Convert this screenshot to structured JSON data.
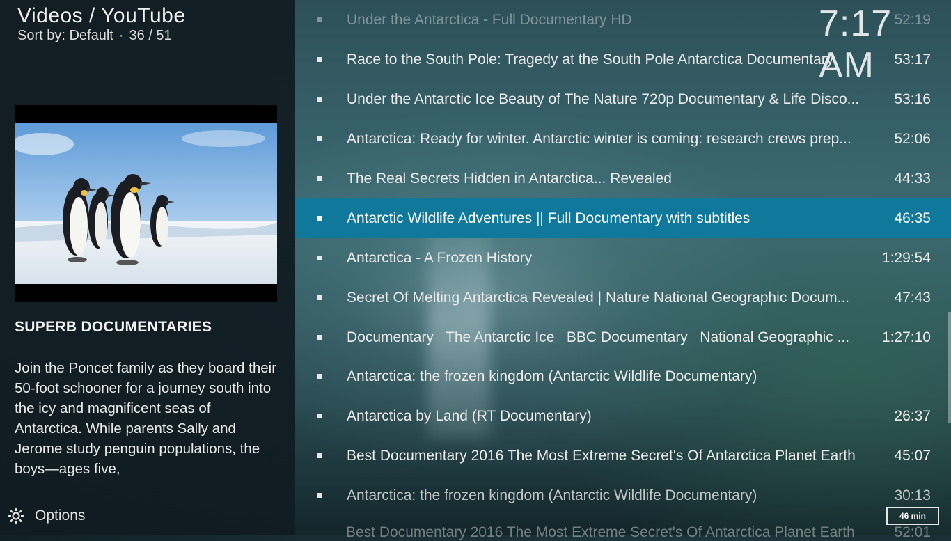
{
  "header": {
    "title": "Videos / YouTube",
    "sort_label": "Sort by: Default",
    "separator": "·",
    "position": "36 / 51"
  },
  "clock": "7:17 AM",
  "info": {
    "plot_title": "SUPERB DOCUMENTARIES",
    "plot": "Join the Poncet family as they board their 50-foot schooner for a journey south into the icy and magnificent seas of Antarctica. While parents Sally and Jerome study penguin populations, the boys—ages five,"
  },
  "options_label": "Options",
  "badge": "46 min",
  "items": [
    {
      "label": "Under the Antarctica - Full Documentary HD",
      "duration": "52:19"
    },
    {
      "label": "Race to the South Pole: Tragedy at the South Pole Antarctica Documentary",
      "duration": "53:17"
    },
    {
      "label": "Under the Antarctic Ice Beauty of The Nature 720p Documentary & Life Disco...",
      "duration": "53:16"
    },
    {
      "label": "Antarctica: Ready for winter. Antarctic winter is coming: research crews prep...",
      "duration": "52:06"
    },
    {
      "label": "The Real Secrets Hidden in Antarctica... Revealed",
      "duration": "44:33"
    },
    {
      "label": "Antarctic Wildlife Adventures || Full Documentary with subtitles",
      "duration": "46:35"
    },
    {
      "label": "Antarctica - A Frozen History",
      "duration": "1:29:54"
    },
    {
      "label": "Secret Of Melting Antarctica Revealed | Nature National Geographic Docum...",
      "duration": "47:43"
    },
    {
      "label": "Documentary   The Antarctic Ice   BBC Documentary   National Geographic ...",
      "duration": "1:27:10"
    },
    {
      "label": "Antarctica: the frozen kingdom (Antarctic Wildlife Documentary)",
      "duration": ""
    },
    {
      "label": "Antarctica by Land (RT Documentary)",
      "duration": "26:37"
    },
    {
      "label": "Best Documentary 2016 The Most Extreme Secret's Of Antarctica Planet Earth",
      "duration": "45:07"
    },
    {
      "label": "Antarctica: the frozen kingdom (Antarctic Wildlife Documentary)",
      "duration": "30:13"
    },
    {
      "label": "Best Documentary 2016 The Most Extreme Secret's Of Antarctica Planet Earth",
      "duration": "52:01"
    }
  ],
  "colors": {
    "selection": "#10789a",
    "text": "#eaeaea"
  },
  "icons": {
    "options": "gear-icon",
    "thumbnail": "penguin-thumbnail"
  }
}
